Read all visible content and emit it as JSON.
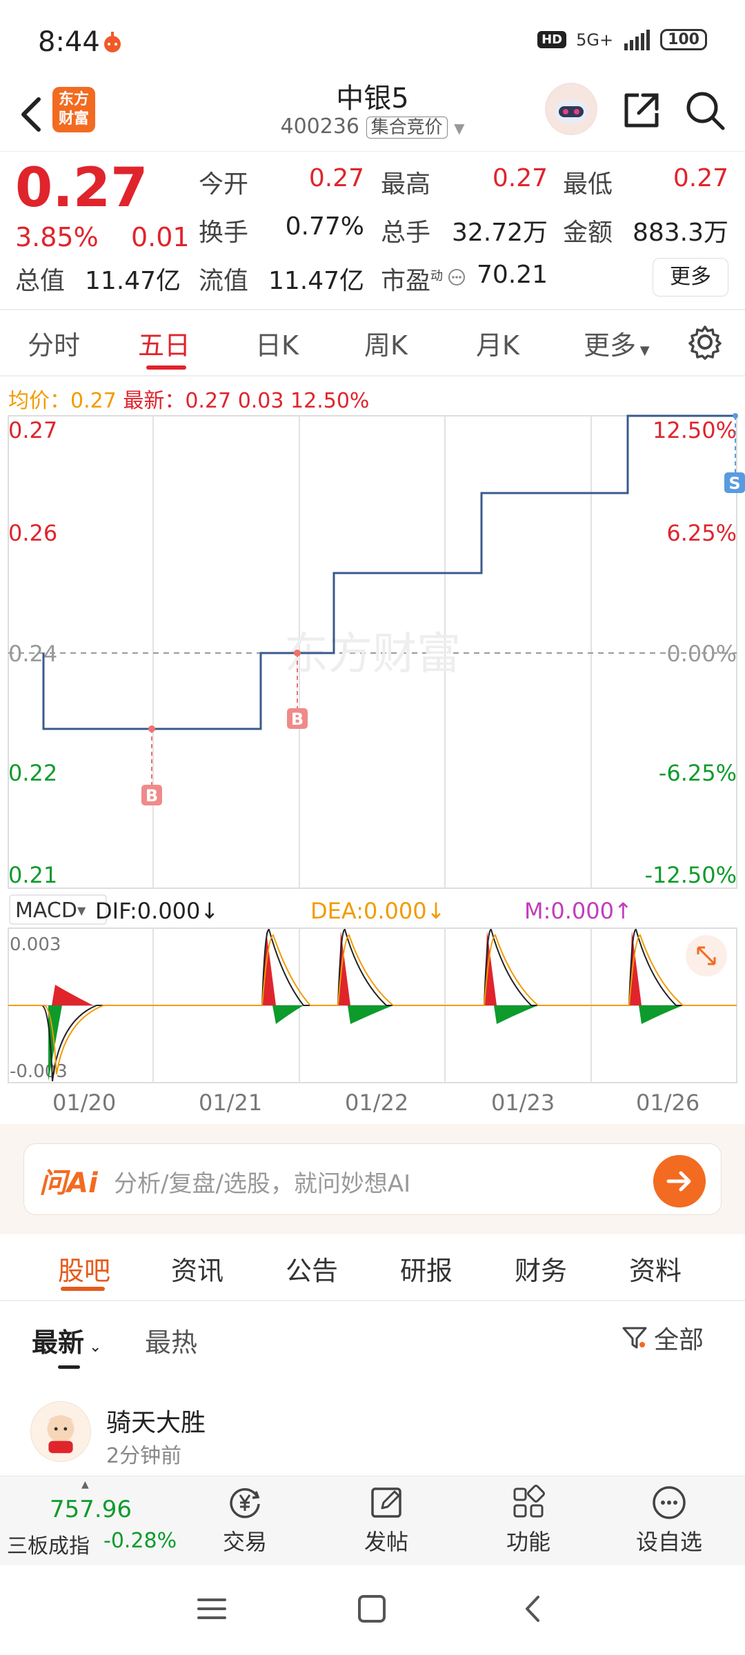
{
  "status_bar": {
    "time": "8:44",
    "hd": "HD",
    "network": "5G+",
    "battery": "100"
  },
  "header": {
    "app_logo_text": [
      "东方",
      "财富"
    ],
    "stock_name": "中银5",
    "stock_code": "400236",
    "auction_tag": "集合竞价"
  },
  "quote": {
    "price": "0.27",
    "change_pct": "3.85%",
    "change_amt": "0.01",
    "open_label": "今开",
    "open": "0.27",
    "high_label": "最高",
    "high": "0.27",
    "low_label": "最低",
    "low": "0.27",
    "turnover_label": "换手",
    "turnover": "0.77%",
    "volume_label": "总手",
    "volume": "32.72万",
    "amount_label": "金额",
    "amount": "883.3万",
    "mktcap_label": "总值",
    "mktcap": "11.47亿",
    "float_label": "流值",
    "float": "11.47亿",
    "pe_label": "市盈",
    "pe_sup": "动",
    "pe": "70.21",
    "more_label": "更多"
  },
  "chart_tabs": [
    "分时",
    "五日",
    "日K",
    "周K",
    "月K",
    "更多"
  ],
  "active_chart_tab": "五日",
  "info_line": {
    "avg_label": "均价：",
    "avg": "0.27",
    "latest_label": "最新：",
    "latest": "0.27",
    "chg": "0.03",
    "chg_pct": "12.50%"
  },
  "chart_data": [
    {
      "type": "line",
      "title": "",
      "x": [
        "01/20",
        "01/21",
        "01/22",
        "01/23",
        "01/26"
      ],
      "series": [
        {
          "values": [
            0.24,
            0.23,
            0.23,
            0.24,
            0.25,
            0.26,
            0.27
          ]
        }
      ],
      "y_labels_left": [
        "0.27",
        "0.26",
        "0.24",
        "0.22",
        "0.21"
      ],
      "y_labels_right": [
        "12.50%",
        "6.25%",
        "0.00%",
        "-6.25%",
        "-12.50%"
      ],
      "markers": [
        {
          "label": "B",
          "date": "01/20"
        },
        {
          "label": "B",
          "date": "01/21"
        },
        {
          "label": "S",
          "date": "01/26"
        }
      ],
      "watermark": "东方财富"
    },
    {
      "type": "bar",
      "title": "MACD",
      "indicator_label": "MACD",
      "dif": "DIF:0.000↓",
      "dea": "DEA:0.000↓",
      "m": "M:0.000↑",
      "y_labels": [
        "0.003",
        "-0.003"
      ],
      "x": [
        "01/20",
        "01/21",
        "01/22",
        "01/23",
        "01/26"
      ]
    }
  ],
  "ai": {
    "logo": "问Ai",
    "placeholder": "分析/复盘/选股，就问妙想AI"
  },
  "section_tabs": [
    "股吧",
    "资讯",
    "公告",
    "研报",
    "财务",
    "资料"
  ],
  "sub_tabs": {
    "latest": "最新",
    "hot": "最热",
    "filter": "全部"
  },
  "post": {
    "author": "骑天大胜",
    "time": "2分钟前"
  },
  "bottom_nav": {
    "index_value": "757.96",
    "index_name": "三板成指",
    "index_change": "-0.28%",
    "items": [
      "交易",
      "发帖",
      "功能",
      "设自选"
    ]
  },
  "colors": {
    "up": "#e0242c",
    "down": "#0d9b2c",
    "accent": "#f26b21",
    "line": "#3a5a8c"
  }
}
